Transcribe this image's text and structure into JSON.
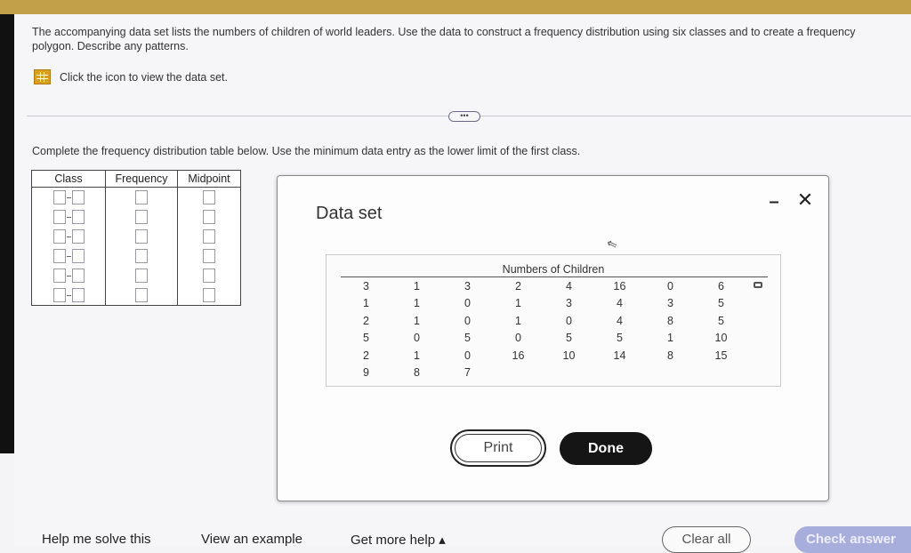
{
  "question": {
    "text": "The accompanying data set lists the numbers of children of world leaders. Use the data to construct a frequency distribution using six classes and to create a frequency polygon. Describe any patterns."
  },
  "dataset_link": {
    "icon": "grid-icon",
    "label": "Click the icon to view the data set."
  },
  "expand_button": {
    "label": "•••"
  },
  "instruction": "Complete the frequency distribution table below. Use the minimum data entry as the lower limit of the first class.",
  "freq_table": {
    "headers": [
      "Class",
      "Frequency",
      "Midpoint"
    ],
    "row_count": 6
  },
  "modal": {
    "title": "Data set",
    "minimize_label": "–",
    "close_label": "✕",
    "data_header": "Numbers of Children",
    "rows": [
      [
        "3",
        "1",
        "3",
        "2",
        "4",
        "16",
        "0",
        "6"
      ],
      [
        "1",
        "1",
        "0",
        "1",
        "3",
        "4",
        "3",
        "5"
      ],
      [
        "2",
        "1",
        "0",
        "1",
        "0",
        "4",
        "8",
        "5"
      ],
      [
        "5",
        "0",
        "5",
        "0",
        "5",
        "5",
        "1",
        "10"
      ],
      [
        "2",
        "1",
        "0",
        "16",
        "10",
        "14",
        "8",
        "15"
      ],
      [
        "9",
        "8",
        "7",
        "",
        "",
        "",
        "",
        ""
      ]
    ],
    "print_label": "Print",
    "done_label": "Done"
  },
  "footer": {
    "help_me_solve": "Help me solve this",
    "view_example": "View an example",
    "get_more_help": "Get more help ▴",
    "clear_all": "Clear all",
    "check_answer": "Check answer"
  },
  "colors": {
    "top_bar": "#c2a04a",
    "done_button": "#151515",
    "check_answer_button": "#a7aedc",
    "icon_accent": "#d9a020"
  }
}
